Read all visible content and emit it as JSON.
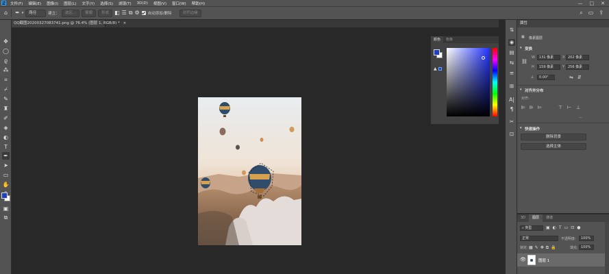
{
  "app": {
    "logo_text": "Ps"
  },
  "menubar": {
    "items": [
      "文件(F)",
      "编辑(E)",
      "图像(I)",
      "图层(L)",
      "文字(Y)",
      "选择(S)",
      "滤镜(T)",
      "3D(D)",
      "视图(V)",
      "窗口(W)",
      "帮助(H)"
    ],
    "controls": [
      "—",
      "□",
      "✕"
    ]
  },
  "options": {
    "mode_label": "路径",
    "build_label": "建立：",
    "selection_label": "选区...",
    "mask_label": "蒙版",
    "shape_label": "形状",
    "auto_add_label": "自动添加/删除",
    "align_edges_label": "对齐边缘"
  },
  "document": {
    "tab_title": "QQ截图20200327083741.png @ 76.4% (图层 1, RGB/8) *",
    "close": "×"
  },
  "color_panel": {
    "tabs": [
      "颜色",
      "色板"
    ],
    "fg_color": "#1f3fbf",
    "bg_color": "#ffffff"
  },
  "properties": {
    "tab": "属性",
    "layer_type": "像素图层",
    "transform_title": "变换",
    "w_label": "W",
    "w_value": "131 像素",
    "x_label": "X",
    "x_value": "202 像素",
    "h_label": "H",
    "h_value": "159 像素",
    "y_label": "Y",
    "y_value": "256 像素",
    "angle_value": "0.00°",
    "align_title": "对齐并分布",
    "align_label": "对齐:",
    "quick_title": "快速操作",
    "remove_bg": "删除背景",
    "select_subject": "选择主体"
  },
  "layers": {
    "tabs": [
      "3D",
      "图层",
      "通道"
    ],
    "filter_label": "类型",
    "blend_mode": "正常",
    "opacity_label": "不透明度:",
    "opacity_value": "100%",
    "lock_label": "锁定:",
    "fill_label": "填充:",
    "fill_value": "100%",
    "layer_name": "图层 1"
  },
  "accent_colors": {
    "selection_blue": "#1f3fbf",
    "panel_gray": "#535353"
  }
}
